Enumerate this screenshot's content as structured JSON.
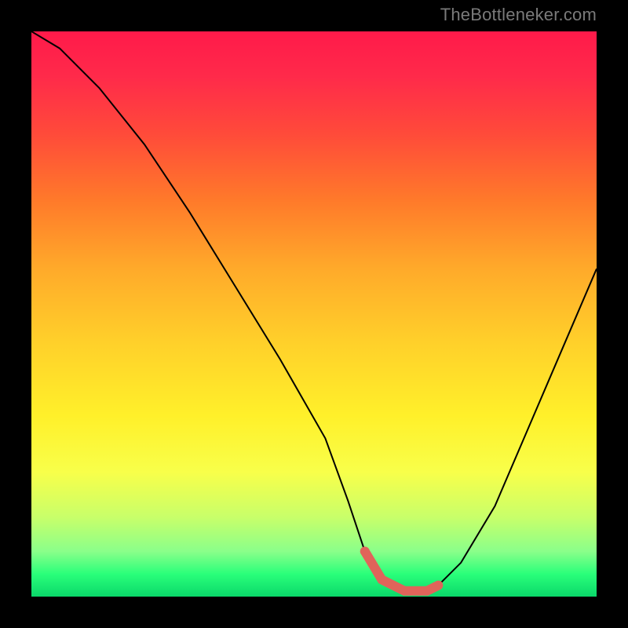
{
  "attribution": "TheBottleneker.com",
  "colors": {
    "curve": "#000000",
    "highlight": "#e0645a"
  },
  "chart_data": {
    "type": "line",
    "title": "",
    "xlabel": "",
    "ylabel": "",
    "xlim": [
      0,
      100
    ],
    "ylim": [
      0,
      100
    ],
    "series": [
      {
        "name": "bottleneck-curve",
        "x": [
          0,
          5,
          12,
          20,
          28,
          36,
          44,
          52,
          56,
          59,
          62,
          66,
          70,
          72,
          76,
          82,
          88,
          94,
          100
        ],
        "y": [
          100,
          97,
          90,
          80,
          68,
          55,
          42,
          28,
          17,
          8,
          3,
          1,
          1,
          2,
          6,
          16,
          30,
          44,
          58
        ]
      }
    ],
    "highlight": {
      "name": "optimal-range",
      "x": [
        59,
        62,
        66,
        70,
        72
      ],
      "y": [
        8,
        3,
        1,
        1,
        2
      ]
    },
    "gradient_stops": [
      {
        "pos": 0.0,
        "color": "#ff1a4a"
      },
      {
        "pos": 0.5,
        "color": "#ffe02a"
      },
      {
        "pos": 1.0,
        "color": "#0ad86a"
      }
    ]
  }
}
